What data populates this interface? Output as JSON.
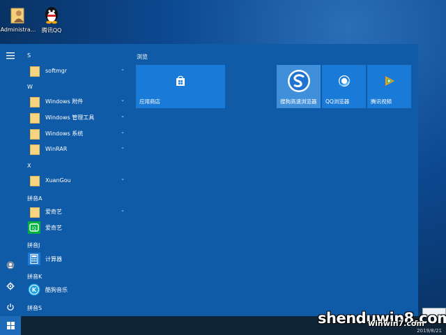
{
  "desktop": {
    "icons": [
      {
        "label": "Administra...",
        "icon": "user-folder-icon"
      },
      {
        "label": "腾讯QQ",
        "icon": "qq-penguin-icon"
      }
    ]
  },
  "start_menu": {
    "groups": [
      {
        "letter": "S"
      },
      {
        "letter": "W"
      },
      {
        "letter": "X"
      },
      {
        "letter": "拼音A"
      },
      {
        "letter": "拼音J"
      },
      {
        "letter": "拼音K"
      },
      {
        "letter": "拼音S"
      }
    ],
    "apps": [
      {
        "label": "softmgr",
        "expandable": true,
        "icon": "folder-icon"
      },
      {
        "label": "Windows 附件",
        "expandable": true,
        "icon": "folder-icon"
      },
      {
        "label": "Windows 管理工具",
        "expandable": true,
        "icon": "folder-icon"
      },
      {
        "label": "Windows 系统",
        "expandable": true,
        "icon": "folder-icon"
      },
      {
        "label": "WinRAR",
        "expandable": true,
        "icon": "folder-icon"
      },
      {
        "label": "XuanGou",
        "expandable": true,
        "icon": "folder-icon"
      },
      {
        "label": "爱奇艺",
        "expandable": true,
        "icon": "folder-icon"
      },
      {
        "label": "爱奇艺",
        "expandable": false,
        "icon": "iqiyi-icon"
      },
      {
        "label": "计算器",
        "expandable": false,
        "icon": "calculator-icon"
      },
      {
        "label": "酷狗音乐",
        "expandable": false,
        "icon": "kugou-icon"
      }
    ],
    "chevron": "⌄",
    "tiles_group_title": "浏览",
    "tiles": [
      {
        "label": "应用商店",
        "icon": "store-icon"
      },
      {
        "label": "搜狗高速浏览器",
        "icon": "sogou-browser-icon"
      },
      {
        "label": "QQ浏览器",
        "icon": "qq-browser-icon"
      },
      {
        "label": "腾讯视频",
        "icon": "tencent-video-icon"
      }
    ],
    "rail": {
      "menu_icon": "hamburger-icon",
      "user_icon": "user-avatar-icon",
      "settings_icon": "gear-icon",
      "power_icon": "power-icon"
    }
  },
  "watermark": {
    "text": "shenduwin8.com",
    "subtext": "winwin7.com"
  },
  "taskbar": {
    "date": "2019/8/21",
    "start_icon": "windows-logo-icon"
  },
  "colors": {
    "menu_bg": "#0f5ba8",
    "tile_bg": "#1a7ad8",
    "taskbar_bg": "#102438"
  }
}
